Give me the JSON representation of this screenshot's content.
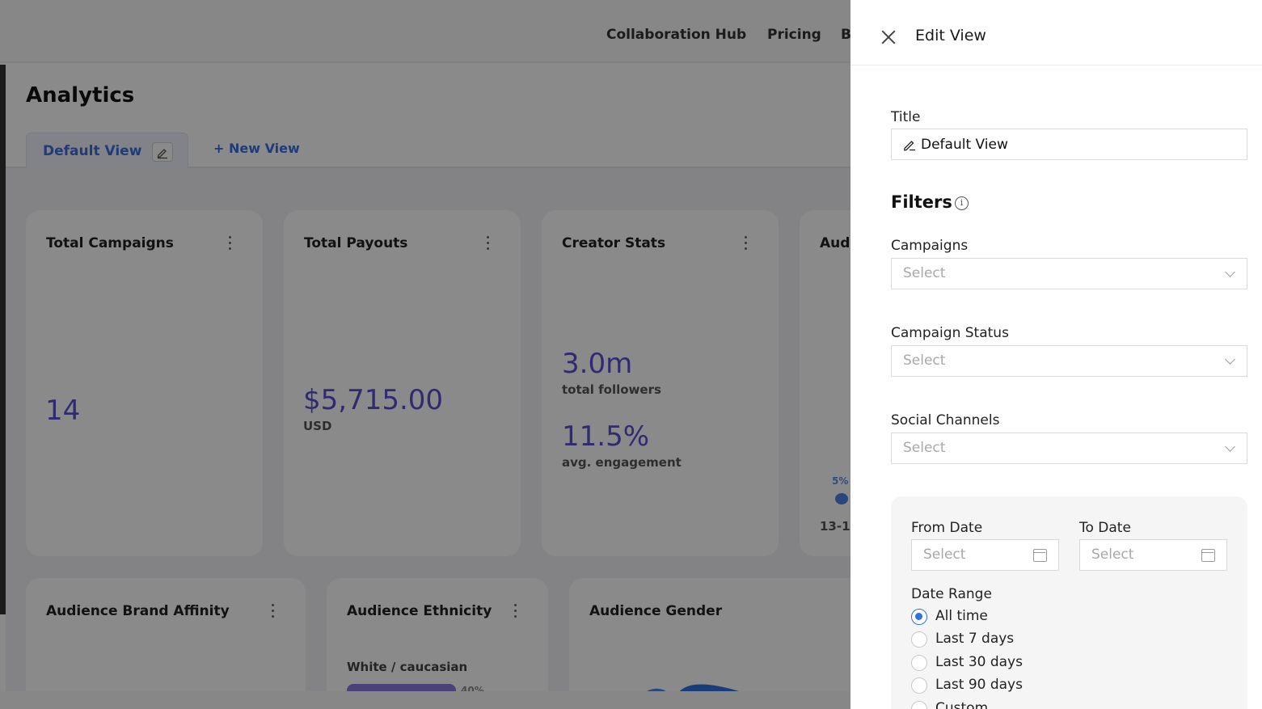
{
  "nav": {
    "items": [
      "Collaboration Hub",
      "Pricing",
      "B"
    ]
  },
  "page": {
    "title": "Analytics",
    "tabs": {
      "active": "Default View",
      "new_view": "+ New View"
    }
  },
  "cards": {
    "total_campaigns": {
      "title": "Total Campaigns",
      "value": "14"
    },
    "total_payouts": {
      "title": "Total Payouts",
      "value": "$5,715.00",
      "unit": "USD"
    },
    "creator_stats": {
      "title": "Creator Stats",
      "followers": "3.0m",
      "followers_label": "total followers",
      "engagement": "11.5%",
      "engagement_label": "avg. engagement"
    },
    "audience_partial": {
      "title": "Aud",
      "pct": "5%",
      "range": "13-1"
    },
    "brand_affinity": {
      "title": "Audience Brand Affinity"
    },
    "ethnicity": {
      "title": "Audience Ethnicity",
      "first_row": "White / caucasian",
      "first_pct": "40%"
    },
    "gender": {
      "title": "Audience Gender"
    }
  },
  "drawer": {
    "title": "Edit View",
    "title_label": "Title",
    "title_value": "Default View",
    "filters_label": "Filters",
    "info_glyph": "i",
    "campaigns": {
      "label": "Campaigns",
      "placeholder": "Select"
    },
    "campaign_status": {
      "label": "Campaign Status",
      "placeholder": "Select"
    },
    "social_channels": {
      "label": "Social Channels",
      "placeholder": "Select"
    },
    "from_date": {
      "label": "From Date",
      "placeholder": "Select"
    },
    "to_date": {
      "label": "To Date",
      "placeholder": "Select"
    },
    "date_range": {
      "label": "Date Range",
      "options": [
        "All time",
        "Last 7 days",
        "Last 30 days",
        "Last 90 days",
        "Custom"
      ],
      "selected": "All time"
    }
  },
  "colors": {
    "accent": "#2f6fe4",
    "tab_accent": "#3b6de0",
    "metric": "#5a4fd0",
    "overlay": "rgba(0,0,0,0.46)"
  }
}
